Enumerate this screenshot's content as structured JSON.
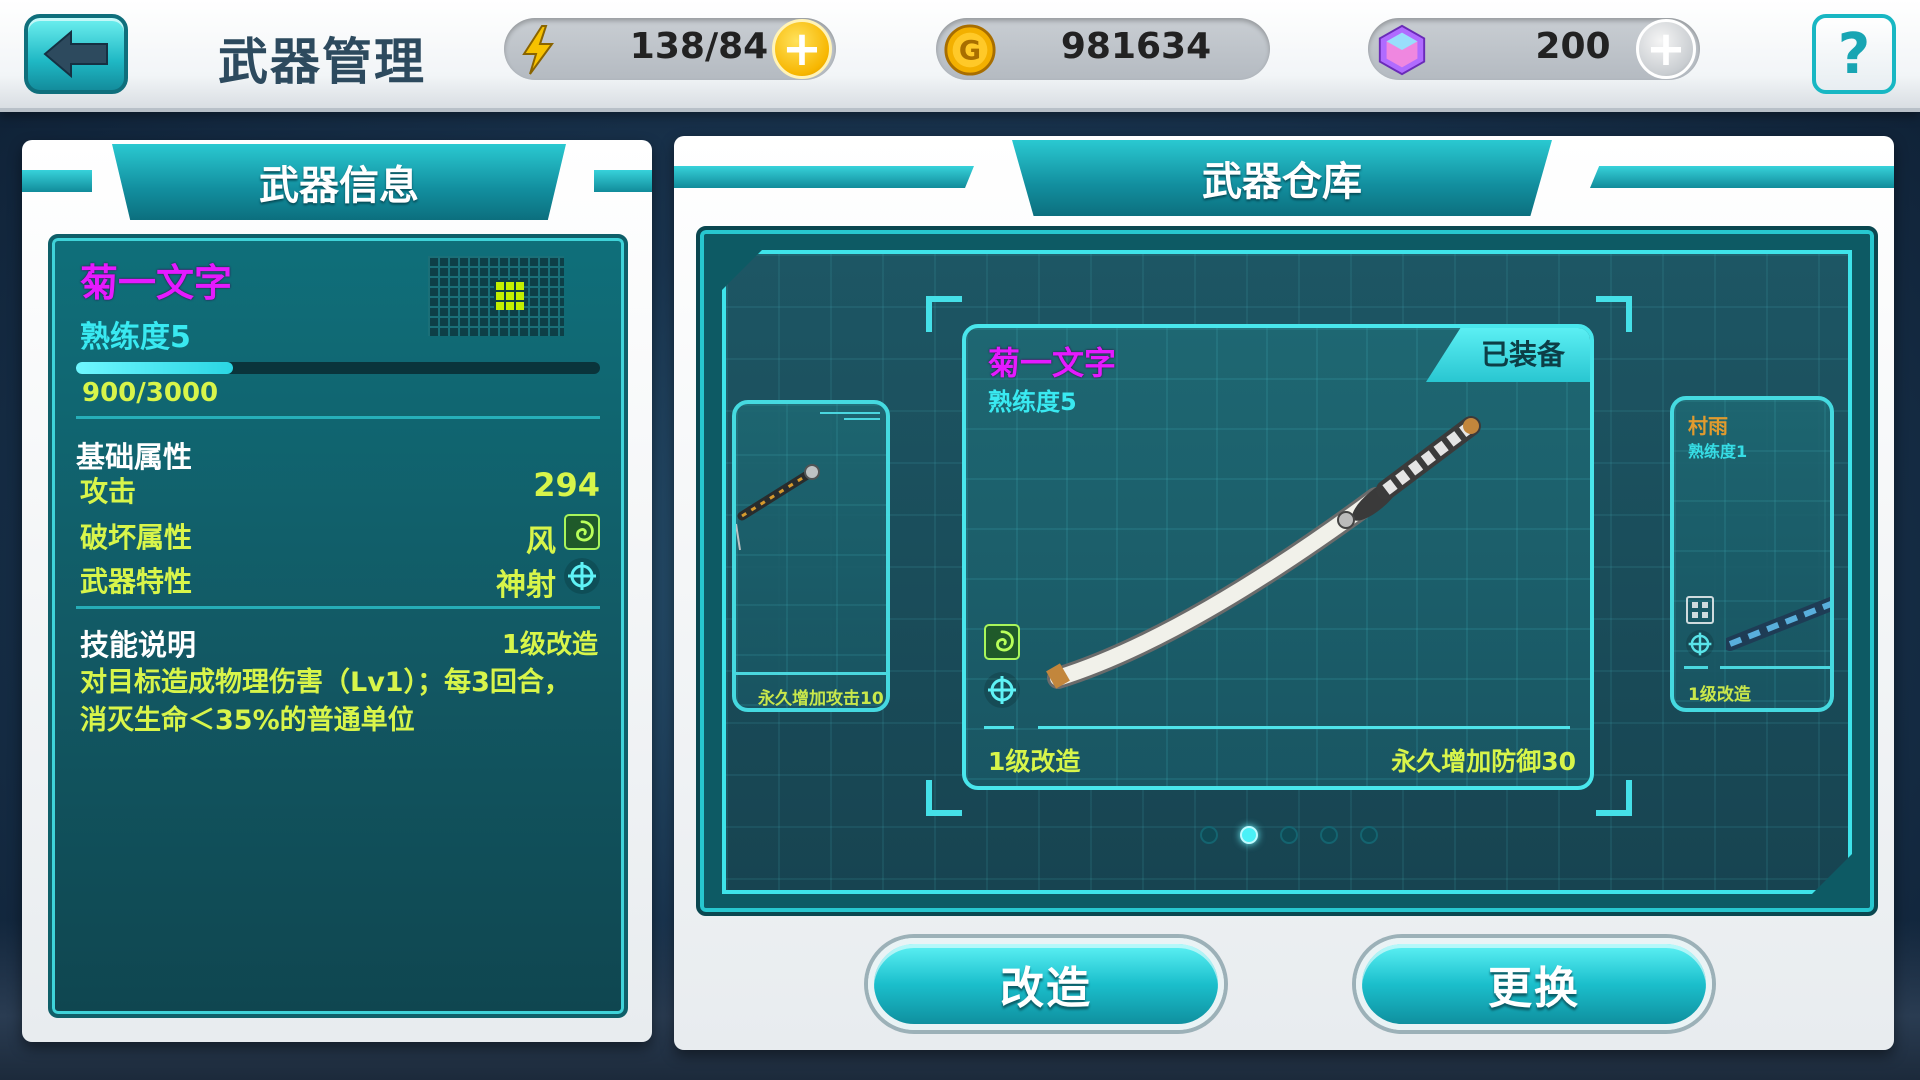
{
  "header": {
    "title": "武器管理",
    "energy": "138/84",
    "gold": "981634",
    "gems": "200",
    "help_label": "?"
  },
  "info_panel": {
    "title": "武器信息",
    "weapon_name": "菊一文字",
    "proficiency": "熟练度5",
    "exp_text": "900/3000",
    "exp_fraction": 0.3,
    "base_attr_title": "基础属性",
    "attrs": [
      {
        "label": "攻击",
        "value": "294"
      },
      {
        "label": "破坏属性",
        "value": "风"
      },
      {
        "label": "武器特性",
        "value": "神射"
      }
    ],
    "skill_title": "技能说明",
    "skill_level": "1级改造",
    "skill_desc_line1": "对目标造成物理伤害（Lv1）；每3回合，",
    "skill_desc_line2": "消灭生命＜35%的普通单位"
  },
  "warehouse": {
    "title": "武器仓库",
    "main_card": {
      "name": "菊一文字",
      "proficiency": "熟练度5",
      "equipped": "已装备",
      "upgrade": "1级改造",
      "bonus": "永久增加防御30"
    },
    "left_card": {
      "bonus": "永久增加攻击10"
    },
    "right_card": {
      "name": "村雨",
      "proficiency": "熟练度1",
      "upgrade": "1级改造"
    },
    "page_count": 5,
    "active_page": 2
  },
  "actions": {
    "modify": "改造",
    "replace": "更换"
  },
  "colors": {
    "accent": "#1fb8c4",
    "name_magenta": "#e51aff",
    "yellow_text": "#d8f54a",
    "cyan_text": "#39e9f1"
  }
}
